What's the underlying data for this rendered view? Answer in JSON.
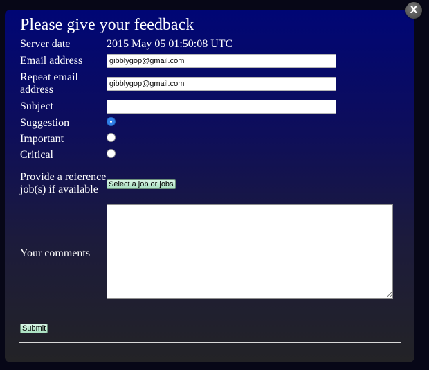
{
  "form": {
    "title": "Please give your feedback",
    "server_date_label": "Server date",
    "server_date_value": "2015 May 05 01:50:08 UTC",
    "email_label": "Email address",
    "email_value": "gibblygop@gmail.com",
    "repeat_email_label": "Repeat email address",
    "repeat_email_value": "gibblygop@gmail.com",
    "subject_label": "Subject",
    "subject_value": "",
    "priority_options": [
      {
        "label": "Suggestion",
        "checked": true
      },
      {
        "label": "Important",
        "checked": false
      },
      {
        "label": "Critical",
        "checked": false
      }
    ],
    "reference_label": "Provide a reference job(s) if available",
    "select_job_label": "Select a job or jobs",
    "comments_label": "Your comments",
    "comments_value": "",
    "submit_label": "Submit"
  },
  "close_label": "X",
  "colors": {
    "dialog_top": "#000675",
    "dialog_bottom": "#232326",
    "button_bg": "#bdeacf",
    "radio_checked": "#2f7fe8"
  }
}
